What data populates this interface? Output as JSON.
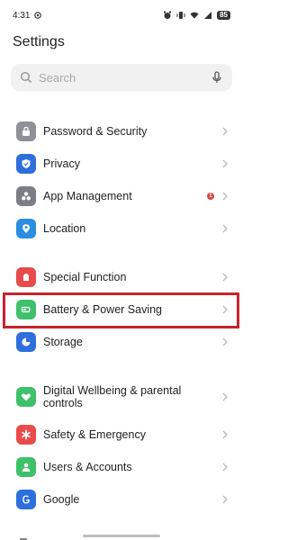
{
  "status_bar": {
    "time": "4:31",
    "battery": "85",
    "icons": [
      "notification-icon",
      "alarm-icon",
      "vibrate-icon",
      "wifi-icon",
      "signal-icon",
      "battery-icon"
    ]
  },
  "page_title": "Settings",
  "search": {
    "placeholder": "Search"
  },
  "settings_items": [
    {
      "label": "Password & Security",
      "icon": "lock-icon",
      "color": "#8e9197"
    },
    {
      "label": "Privacy",
      "icon": "shield-icon",
      "color": "#2d6fdc"
    },
    {
      "label": "App Management",
      "icon": "app-grid-icon",
      "color": "#7b7e86",
      "badge": "1"
    },
    {
      "label": "Location",
      "icon": "location-pin-icon",
      "color": "#2a8de0"
    },
    {
      "label": "Special Function",
      "icon": "special-function-icon",
      "color": "#e84b4b"
    },
    {
      "label": "Battery & Power Saving",
      "icon": "battery-icon",
      "color": "#3fc06a"
    },
    {
      "label": "Storage",
      "icon": "pie-chart-icon",
      "color": "#2d6fdc"
    },
    {
      "label": "Digital Wellbeing & parental controls",
      "icon": "heart-icon",
      "color": "#3fc06a"
    },
    {
      "label": "Safety & Emergency",
      "icon": "emergency-icon",
      "color": "#e84b4b"
    },
    {
      "label": "Users & Accounts",
      "icon": "user-icon",
      "color": "#3fc06a"
    },
    {
      "label": "Google",
      "icon": "google-icon",
      "color": "#2d6fdc"
    }
  ],
  "highlighted_item": "Battery & Power Saving",
  "accent_colors": {
    "highlight_frame": "#c8232b",
    "badge": "#d9463e"
  }
}
